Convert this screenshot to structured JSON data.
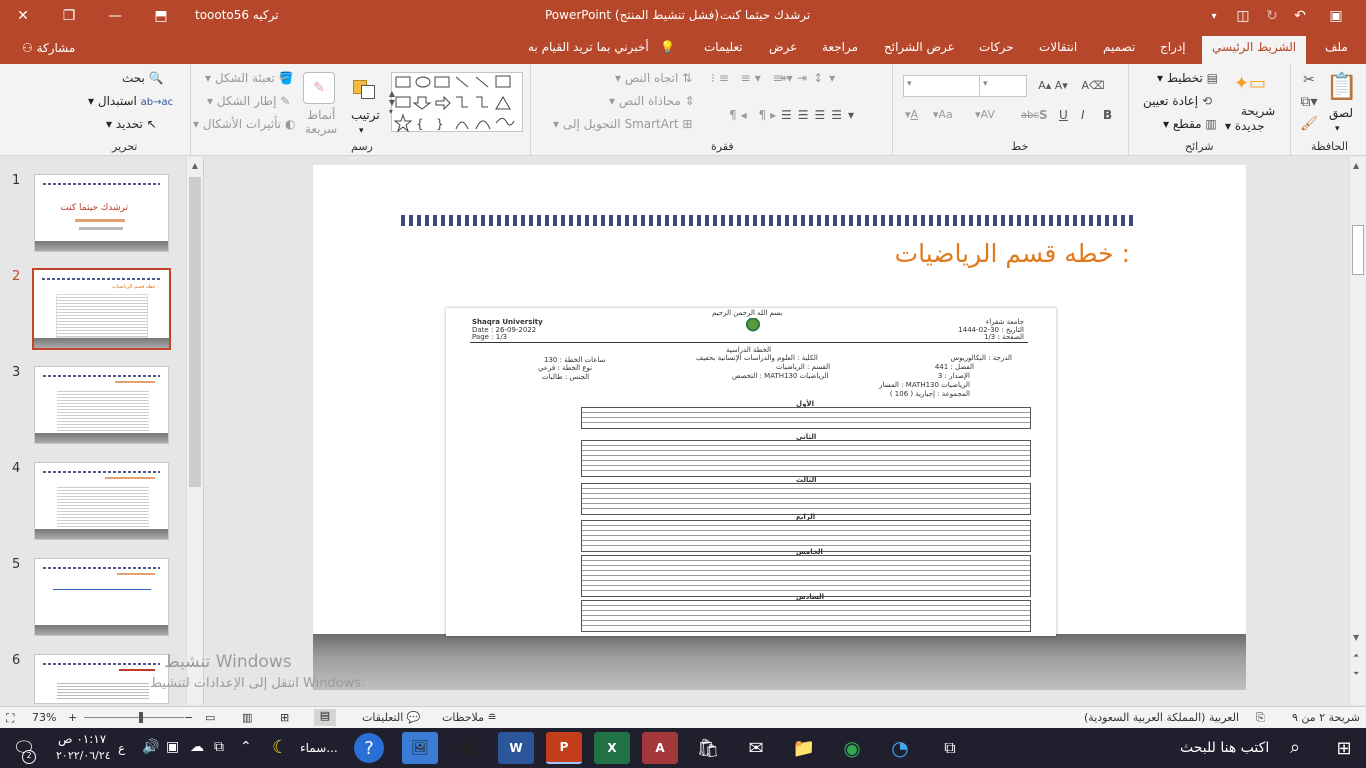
{
  "app": {
    "filename": "ترشدك حيثما كنت",
    "title_suffix": "PowerPoint (فشل تنشيط المنتج)",
    "account": "toooto56 تركيه",
    "share": "مشاركة"
  },
  "tabs": [
    {
      "label": "ملف"
    },
    {
      "label": "الشريط الرئيسي",
      "active": true
    },
    {
      "label": "إدراج"
    },
    {
      "label": "تصميم"
    },
    {
      "label": "انتقالات"
    },
    {
      "label": "حركات"
    },
    {
      "label": "عرض الشرائح"
    },
    {
      "label": "مراجعة"
    },
    {
      "label": "عرض"
    },
    {
      "label": "تعليمات"
    },
    {
      "label": "أخبرني بما تريد القيام به"
    }
  ],
  "ribbon": {
    "clipboard": {
      "group": "الحافظة",
      "paste": "لصق"
    },
    "slides": {
      "group": "شرائح",
      "new_slide_1": "شريحة",
      "new_slide_2": "جديدة",
      "layout": "تخطيط",
      "reset": "إعادة تعيين",
      "section": "مقطع"
    },
    "font": {
      "group": "خط",
      "b": "B",
      "i": "I",
      "u": "U",
      "s": "S",
      "abc": "abc",
      "av": "AV",
      "aa": "Aa"
    },
    "paragraph": {
      "group": "فقرة",
      "text_direction": "اتجاه النص",
      "align_text": "محاذاة النص",
      "smartart": "التحويل إلى SmartArt"
    },
    "drawing": {
      "group": "رسم",
      "arrange": "ترتيب",
      "quick_styles_1": "أنماط",
      "quick_styles_2": "سريعة",
      "shape_fill": "تعبئة الشكل",
      "shape_outline": "إطار الشكل",
      "shape_effects": "تأثيرات الأشكال"
    },
    "editing": {
      "group": "تحرير",
      "find": "بحث",
      "replace": "استبدال",
      "select": "تحديد"
    }
  },
  "slides": [
    {
      "num": "1",
      "title": "ترشدك حيثما كنت"
    },
    {
      "num": "2",
      "title": "خطه قسم الرياضيات :"
    },
    {
      "num": "3",
      "title": ""
    },
    {
      "num": "4",
      "title": ""
    },
    {
      "num": "5",
      "title": ""
    },
    {
      "num": "6",
      "title": ""
    }
  ],
  "current_slide": {
    "title": "خطه قسم الرياضيات :",
    "doc": {
      "university_en": "Shaqra University",
      "date": "Date : 26-09-2022",
      "page": "Page : 1/3",
      "basmala": "بسم الله الرحمن الرحيم",
      "university_ar": "جامعة شقراء",
      "hijri": "التاريخ : 30-02-1444",
      "page_ar": "الصفحة : 1/3",
      "plan_heading": "الخطة الدراسية",
      "degree": "الدرجة : البكالوريوس",
      "college": "الكلية : العلوم والدراسات الإنسانية بحفيف",
      "hours": "ساعات الخطة : 130",
      "term": "الفصل : 441",
      "dept": "القسم : الرياضيات",
      "plan_type": "نوع الخطة : فرعي",
      "version": "الإصدار : 3",
      "major": "التخصص : MATH130 الرياضيات",
      "gender": "الجنس : طالبات",
      "track": "المسار : MATH130 الرياضيات",
      "group": "المجموعة : إجبارية ( 106 )",
      "levels": [
        "الأول",
        "الثاني",
        "الثالث",
        "الرابع",
        "الخامس",
        "السادس"
      ]
    }
  },
  "watermark": {
    "line1": "تنشيط Windows",
    "line2": "انتقل إلى الإعدادات لتنشيط Windows."
  },
  "status": {
    "slide_counter": "شريحة ٢ من ٩",
    "language": "العربية (المملكة العربية السعودية)",
    "notes": "ملاحظات",
    "comments": "التعليقات",
    "zoom": "73%"
  },
  "taskbar": {
    "search_placeholder": "اكتب هنا للبحث",
    "time": "٠١:١٧ ص",
    "date": "٢٠٢٢/٠٦/٢٤",
    "weather": "سماء...",
    "lang": "ع",
    "notif": "2"
  }
}
